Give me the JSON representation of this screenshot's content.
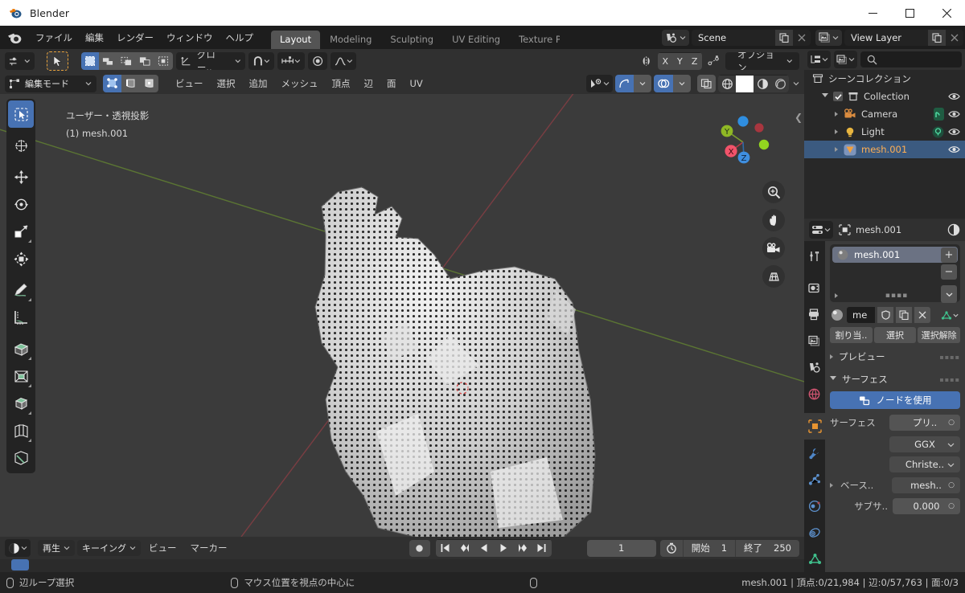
{
  "window": {
    "title": "Blender",
    "logo_icon": "blender-logo-icon",
    "minimize_icon": "minimize-icon",
    "maximize_icon": "maximize-icon",
    "close_icon": "close-icon"
  },
  "topbar": {
    "app_icon": "blender-menu-icon",
    "menus": [
      "ファイル",
      "編集",
      "レンダー",
      "ウィンドウ",
      "ヘルプ"
    ],
    "workspace_tabs": [
      {
        "label": "Layout",
        "active": true
      },
      {
        "label": "Modeling",
        "active": false
      },
      {
        "label": "Sculpting",
        "active": false
      },
      {
        "label": "UV Editing",
        "active": false
      },
      {
        "label": "Texture Paint",
        "active": false
      }
    ],
    "scene": {
      "browse_icon": "scene-browse-icon",
      "name": "Scene",
      "new_icon": "duplicate-icon",
      "unlink_icon": "x-icon"
    },
    "view_layer": {
      "browse_icon": "viewlayer-browse-icon",
      "name": "View Layer",
      "new_icon": "duplicate-icon",
      "unlink_icon": "x-icon"
    }
  },
  "tool_header": {
    "editor_mode_icon": "tool-settings-icon",
    "active_tool_icon": "tweak-cursor-icon",
    "select_modes": [
      "set-select-icon",
      "extend-select-icon",
      "subtract-select-icon",
      "invert-select-icon",
      "intersect-select-icon"
    ],
    "transform_orientation": {
      "icon": "orientation-icon",
      "label": "グロー..",
      "chevron": "chevron-down-icon"
    },
    "snap": {
      "magnet_icon": "magnet-icon",
      "snap_to_icon": "snap-increment-icon",
      "chevron": "chevron-down-icon"
    },
    "pivot": {
      "icon": "pivot-median-icon",
      "label": ""
    },
    "proportional": {
      "icon": "proportional-falloff-icon",
      "chevron": "chevron-down-icon"
    },
    "mirror": {
      "icon": "mirror-icon",
      "axes": [
        "X",
        "Y",
        "Z"
      ]
    },
    "topology_mirror_icon": "topology-mirror-icon",
    "options": {
      "label": "オプション",
      "chevron": "chevron-down-icon"
    }
  },
  "viewport_header": {
    "mode": {
      "icon": "edit-mode-icon",
      "label": "編集モード",
      "chevron": "chevron-down-icon"
    },
    "select_mode_buttons": [
      "vertex-select-icon",
      "edge-select-icon",
      "face-select-icon"
    ],
    "menus": [
      "ビュー",
      "選択",
      "追加",
      "メッシュ",
      "頂点",
      "辺",
      "面",
      "UV"
    ],
    "visibility": {
      "icon": "eye-visibility-icon",
      "chevron": "chevron-down-icon"
    },
    "gizmo": {
      "icon": "gizmo-icon",
      "chevron": "chevron-down-icon",
      "active": true
    },
    "overlays": {
      "icon": "overlays-icon",
      "chevron": "chevron-down-icon",
      "active": true
    },
    "xray_icon": "xray-toggle-icon",
    "shading": [
      "wireframe-shading-icon",
      "solid-shading-icon",
      "material-preview-icon",
      "rendered-shading-icon"
    ],
    "shading_active_index": 1,
    "shading_chevron": "chevron-down-icon"
  },
  "viewport": {
    "overlay_line1": "ユーザー・透視投影",
    "overlay_line2": "(1) mesh.001",
    "collapse_icon": "chevron-left-icon",
    "toolbar": [
      {
        "icon": "tweak-tool-icon",
        "active": true
      },
      {
        "icon": "cursor-tool-icon",
        "active": false
      },
      {
        "icon": "move-tool-icon",
        "active": false
      },
      {
        "icon": "rotate-tool-icon",
        "active": false
      },
      {
        "icon": "scale-tool-icon",
        "active": false
      },
      {
        "icon": "transform-tool-icon",
        "active": false
      },
      {
        "icon": "annotate-tool-icon",
        "active": false
      },
      {
        "icon": "measure-tool-icon",
        "active": false
      },
      {
        "icon": "extrude-region-tool-icon",
        "active": false
      },
      {
        "icon": "inset-faces-tool-icon",
        "active": false
      },
      {
        "icon": "bevel-tool-icon",
        "active": false
      },
      {
        "icon": "loop-cut-tool-icon",
        "active": false
      },
      {
        "icon": "knife-tool-icon",
        "active": false
      }
    ],
    "axis_gizmo": {
      "axes": [
        "X",
        "Y",
        "Z"
      ],
      "color_x": "#f2536a",
      "color_y": "#a5d22a",
      "color_z": "#3f8fe0"
    },
    "nav_buttons": [
      "zoom-icon",
      "pan-hand-icon",
      "camera-view-icon",
      "toggle-perspective-icon"
    ]
  },
  "timeline": {
    "editor_icon": "timeline-editor-icon",
    "editor_chevron": "chevron-down-icon",
    "menus": [
      {
        "label": "再生",
        "chevron": "chevron-down-icon"
      },
      {
        "label": "キーイング",
        "chevron": "chevron-down-icon"
      },
      {
        "label": "ビュー",
        "chevron": ""
      },
      {
        "label": "マーカー",
        "chevron": ""
      }
    ],
    "record_icon": "record-keyframes-icon",
    "playback_icons": [
      "jump-to-start-icon",
      "prev-keyframe-icon",
      "play-reverse-icon",
      "play-icon",
      "next-keyframe-icon",
      "jump-to-end-icon"
    ],
    "current_frame": "1",
    "clock_icon": "use-preview-range-icon",
    "start_label": "開始",
    "start_value": "1",
    "end_label": "終了",
    "end_value": "250"
  },
  "outliner": {
    "display_mode_icon": "outliner-display-mode-icon",
    "filter_icon": "outliner-filter-icon",
    "search_icon": "search-icon",
    "search_placeholder": "",
    "rows": [
      {
        "label": "シーンコレクション",
        "icon": "scene-collection-icon",
        "indent": 0,
        "disclosure": "",
        "checkbox": false,
        "eye": false,
        "selected": false,
        "color": "#d6d6d6"
      },
      {
        "label": "Collection",
        "icon": "collection-icon",
        "indent": 1,
        "disclosure": "down",
        "checkbox": true,
        "eye": true,
        "selected": false,
        "color": "#d6d6d6"
      },
      {
        "label": "Camera",
        "icon": "camera-object-icon",
        "indent": 2,
        "disclosure": "right",
        "checkbox": false,
        "eye": true,
        "selected": false,
        "color": "#d6d6d6"
      },
      {
        "label": "Light",
        "icon": "light-object-icon",
        "indent": 2,
        "disclosure": "right",
        "checkbox": false,
        "eye": true,
        "selected": false,
        "color": "#d6d6d6"
      },
      {
        "label": "mesh.001",
        "icon": "mesh-object-icon",
        "indent": 2,
        "disclosure": "right",
        "checkbox": false,
        "eye": true,
        "selected": true,
        "color": "#ffaf54"
      }
    ]
  },
  "properties": {
    "editor_icon": "properties-editor-icon",
    "editor_chevron": "chevron-down-icon",
    "breadcrumb_object_icon": "object-icon",
    "breadcrumb_object": "mesh.001",
    "breadcrumb_material_icon": "material-icon",
    "tabs": [
      {
        "icon": "tool-tab-icon",
        "active": false
      },
      {
        "icon": "render-tab-icon",
        "active": false
      },
      {
        "icon": "output-tab-icon",
        "active": false
      },
      {
        "icon": "view-layer-tab-icon",
        "active": false
      },
      {
        "icon": "scene-tab-icon",
        "active": false
      },
      {
        "icon": "world-tab-icon",
        "active": false
      },
      {
        "icon": "object-tab-icon",
        "active": true
      },
      {
        "icon": "modifier-tab-icon",
        "active": false
      },
      {
        "icon": "particles-tab-icon",
        "active": false
      },
      {
        "icon": "physics-tab-icon",
        "active": false
      },
      {
        "icon": "constraints-tab-icon",
        "active": false
      },
      {
        "icon": "data-tab-icon",
        "active": false
      }
    ],
    "material_slots": [
      {
        "name": "mesh.001",
        "preview_icon": "material-preview-sphere-icon",
        "selected": true
      }
    ],
    "slot_add_icon": "plus-icon",
    "slot_remove_icon": "minus-icon",
    "slot_menu_icon": "chevron-down-icon",
    "slot_expand_icon": "triangle-right-icon",
    "slot_grip_icon": "grip-dots-icon",
    "material_browse_icon": "material-browse-icon",
    "material_name": "me",
    "material_fake_user_icon": "shield-icon",
    "material_copy_icon": "duplicate-icon",
    "material_unlink_icon": "x-icon",
    "material_datablock_icon": "mesh-data-icon",
    "assign_buttons": [
      "割り当..",
      "選択",
      "選択解除"
    ],
    "panels": [
      {
        "label": "プレビュー",
        "open": false
      },
      {
        "label": "サーフェス",
        "open": true
      }
    ],
    "use_nodes": {
      "icon": "nodetree-icon",
      "label": "ノードを使用"
    },
    "surface_label": "サーフェス",
    "surface_value": "プリ..",
    "distribution_value": "GGX",
    "fresnel_value": "Christe..",
    "base_color_label": "ベース..",
    "base_color_value": "mesh..",
    "subsurface_label": "サブサ..",
    "subsurface_value": "0.000"
  },
  "statusbar": {
    "items": [
      {
        "icon": "mouse-left-icon",
        "label": "辺ループ選択"
      },
      {
        "icon": "mouse-middle-icon",
        "label": "マウス位置を視点の中心に"
      },
      {
        "icon": "mouse-right-icon",
        "label": ""
      }
    ],
    "stats": "mesh.001 | 頂点:0/21,984 | 辺:0/57,763 | 面:0/3"
  },
  "colors": {
    "accent_blue": "#4772b3",
    "window_bg": "#1d1d1d",
    "panel_bg": "#303030",
    "viewport_bg": "#3b3b3b",
    "outliner_bg": "#282828",
    "selected_row": "#3b5a80",
    "object_orange": "#ffaf54"
  }
}
